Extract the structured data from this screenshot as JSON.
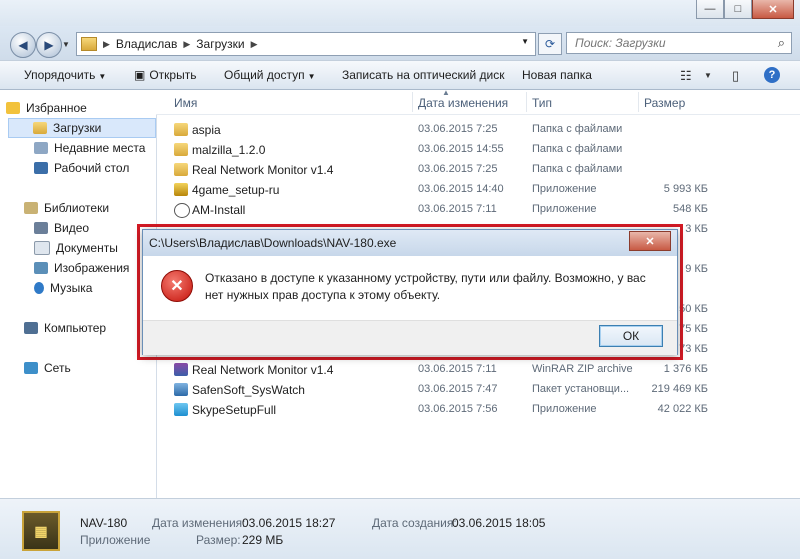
{
  "window": {
    "minimize": "—",
    "maximize": "□",
    "close": "✕"
  },
  "address": {
    "crumbs": [
      "Владислав",
      "Загрузки"
    ],
    "sep": "▶"
  },
  "search": {
    "placeholder": "Поиск: Загрузки"
  },
  "toolbar": {
    "organize": "Упорядочить",
    "open": "Открыть",
    "share": "Общий доступ",
    "burn": "Записать на оптический диск",
    "new_folder": "Новая папка",
    "help": "?"
  },
  "nav": {
    "favorites": "Избранное",
    "downloads": "Загрузки",
    "recent": "Недавние места",
    "desktop": "Рабочий стол",
    "libraries": "Библиотеки",
    "video": "Видео",
    "documents": "Документы",
    "images": "Изображения",
    "music": "Музыка",
    "computer": "Компьютер",
    "network": "Сеть"
  },
  "columns": {
    "name": "Имя",
    "date": "Дата изменения",
    "type": "Тип",
    "size": "Размер"
  },
  "files": [
    {
      "name": "aspia",
      "date": "03.06.2015 7:25",
      "type": "Папка с файлами",
      "size": ""
    },
    {
      "name": "malzilla_1.2.0",
      "date": "03.06.2015 14:55",
      "type": "Папка с файлами",
      "size": ""
    },
    {
      "name": "Real Network Monitor v1.4",
      "date": "03.06.2015 7:25",
      "type": "Папка с файлами",
      "size": ""
    },
    {
      "name": "4game_setup-ru",
      "date": "03.06.2015 14:40",
      "type": "Приложение",
      "size": "5 993 КБ"
    },
    {
      "name": "AM-Install",
      "date": "03.06.2015 7:11",
      "type": "Приложение",
      "size": "548 КБ"
    },
    {
      "name": "Real Network Monitor v1.4",
      "date": "03.06.2015 7:11",
      "type": "WinRAR ZIP archive",
      "size": "1 376 КБ"
    },
    {
      "name": "SafenSoft_SysWatch",
      "date": "03.06.2015 7:47",
      "type": "Пакет установщи...",
      "size": "219 469 КБ"
    },
    {
      "name": "SkypeSetupFull",
      "date": "03.06.2015 7:56",
      "type": "Приложение",
      "size": "42 022 КБ"
    }
  ],
  "hidden_sizes": [
    "3 КБ",
    "9 КБ",
    "50 КБ",
    "75 КБ",
    "73 КБ"
  ],
  "status": {
    "name": "NAV-180",
    "kind": "Приложение",
    "modified_label": "Дата изменения:",
    "modified": "03.06.2015 18:27",
    "created_label": "Дата создания:",
    "created": "03.06.2015 18:05",
    "size_label": "Размер:",
    "size": "229 МБ"
  },
  "dialog": {
    "title": "C:\\Users\\Владислав\\Downloads\\NAV-180.exe",
    "message": "Отказано в доступе к указанному устройству, пути или файлу. Возможно,  у вас нет нужных прав доступа к этому объекту.",
    "ok": "ОК",
    "close": "✕",
    "icon": "error-icon"
  },
  "colors": {
    "dialog_highlight": "#d31a24",
    "selection": "#d9e8fb",
    "error": "#c4120a"
  }
}
